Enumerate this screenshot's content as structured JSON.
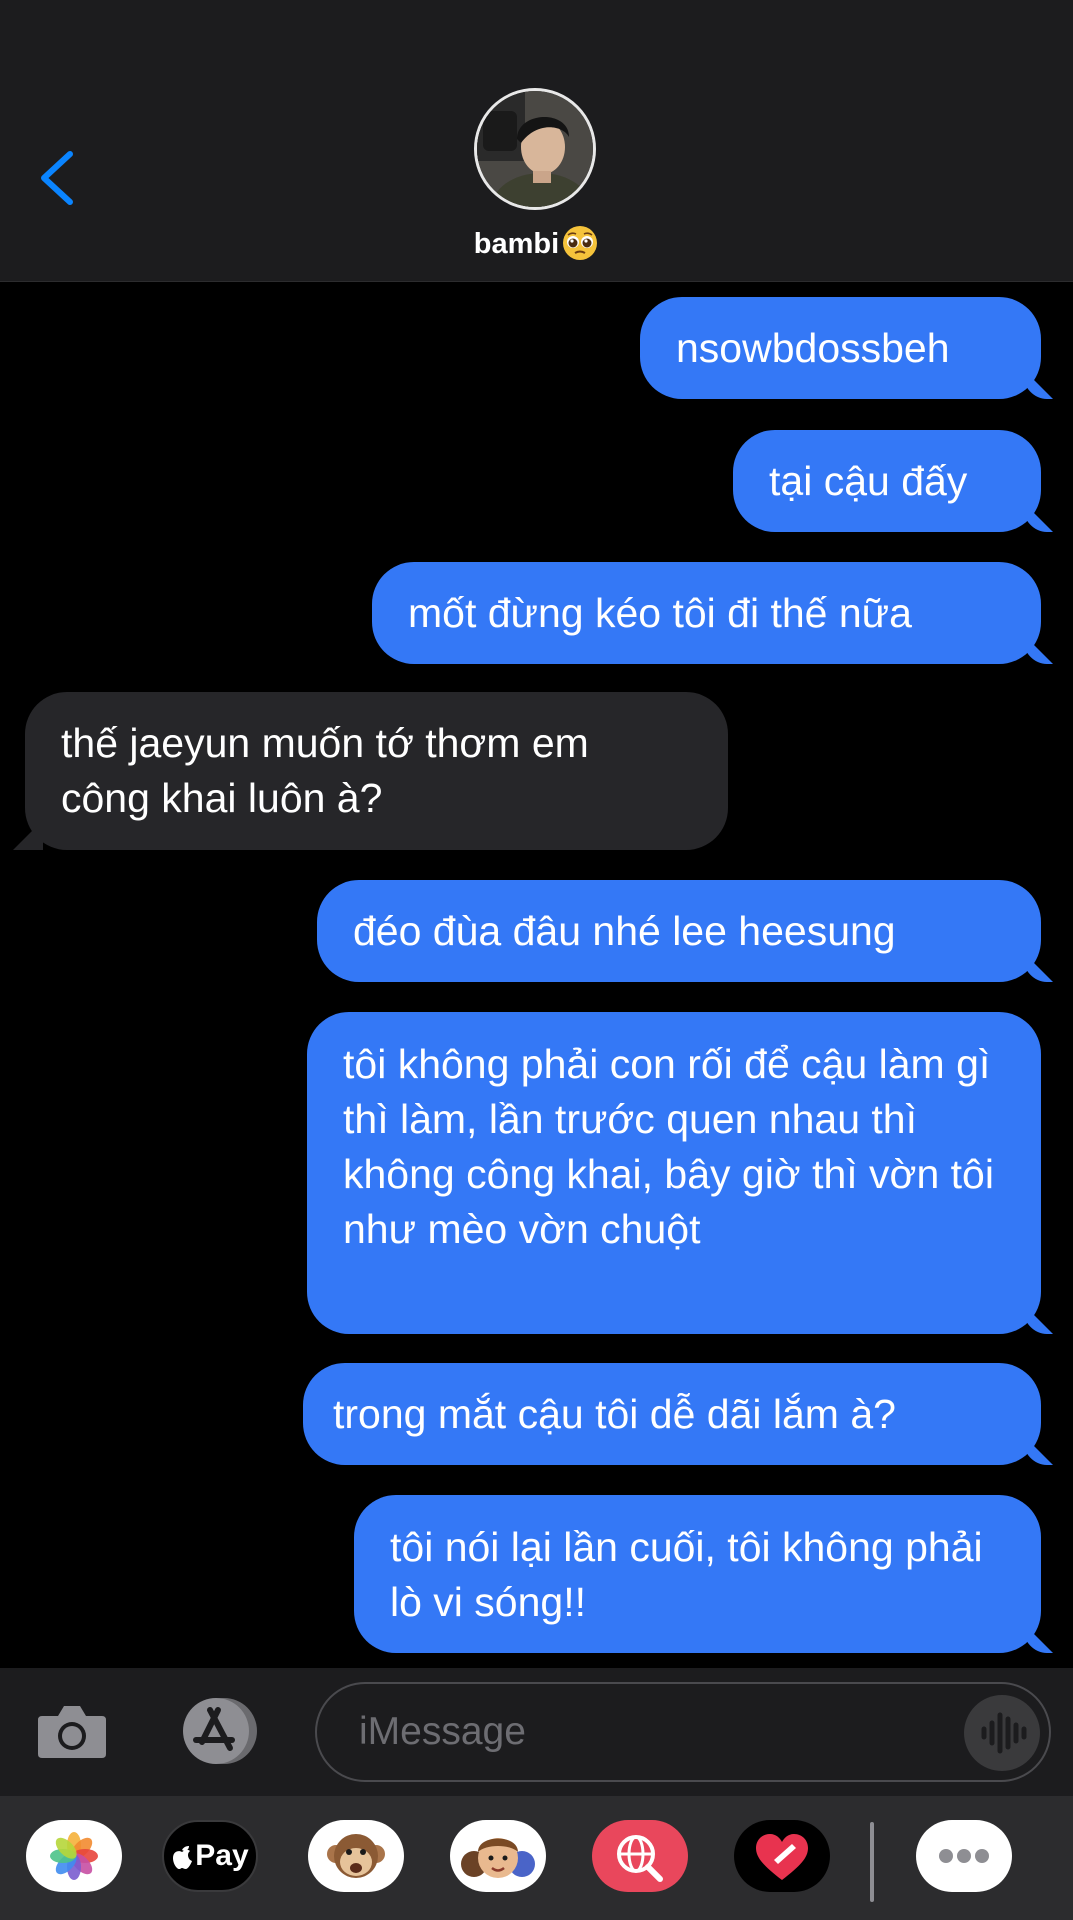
{
  "contact": {
    "name": "bambi",
    "name_emoji": "pleading-face-emoji"
  },
  "messages": [
    {
      "dir": "out",
      "text": "nsowbdossbeh"
    },
    {
      "dir": "out",
      "text": "tại cậu đấy"
    },
    {
      "dir": "out",
      "text": "mốt đừng kéo tôi đi thế nữa"
    },
    {
      "dir": "in",
      "text": "thế jaeyun muốn tớ thơm em công khai luôn à?"
    },
    {
      "dir": "out",
      "text": "đéo đùa đâu nhé lee heesung"
    },
    {
      "dir": "out",
      "text": "tôi không phải con rối để cậu làm gì thì làm, lần trước quen nhau thì không công khai, bây giờ thì vờn tôi như mèo vờn chuột"
    },
    {
      "dir": "out",
      "text": "trong mắt cậu tôi dễ dãi lắm à?"
    },
    {
      "dir": "out",
      "text": "tôi nói lại lần cuối, tôi không phải lò vi sóng!!"
    }
  ],
  "composer": {
    "placeholder": "iMessage"
  },
  "app_drawer": {
    "items": [
      "photos-app",
      "apple-pay",
      "animoji",
      "memoji-stickers",
      "search-images",
      "digital-touch",
      "more"
    ],
    "apple_pay_label": "Pay"
  },
  "colors": {
    "outgoing_bubble": "#3478f6",
    "incoming_bubble": "#262629",
    "header_bg": "#1c1c1e",
    "accent": "#0a84ff"
  }
}
